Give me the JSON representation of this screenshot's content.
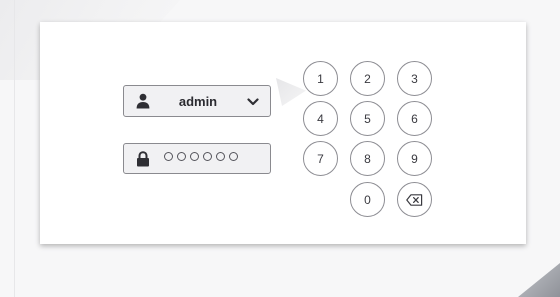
{
  "login": {
    "username": "admin",
    "password_dot_count": 6
  },
  "keypad": {
    "keys": [
      "1",
      "2",
      "3",
      "4",
      "5",
      "6",
      "7",
      "8",
      "9",
      "0"
    ],
    "backspace_icon": "backspace-icon"
  },
  "icons": {
    "user": "user-icon",
    "lock": "lock-icon",
    "dropdown": "chevron-down-icon"
  },
  "colors": {
    "background": "#f7f7f8",
    "card": "#ffffff",
    "field_background": "#f1f1f3",
    "field_border": "#8a8a8f",
    "key_border": "#8d8d93",
    "text": "#2b2b30"
  }
}
